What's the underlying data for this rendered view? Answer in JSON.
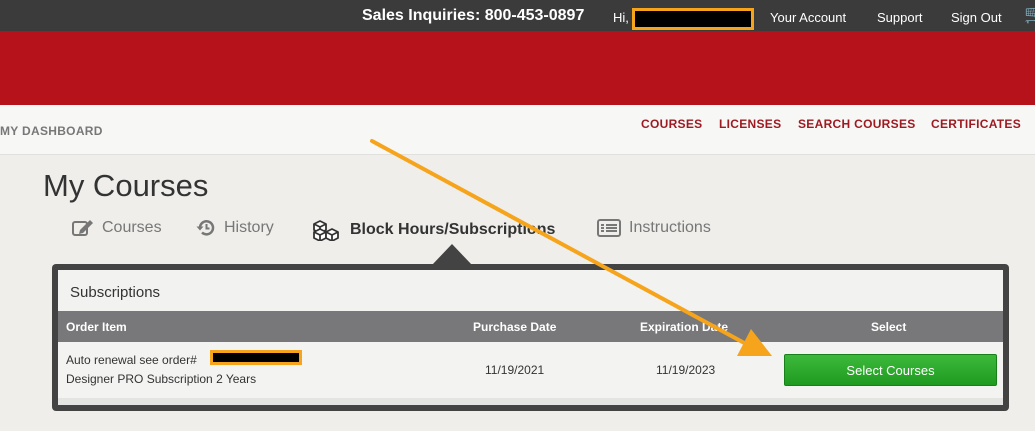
{
  "topbar": {
    "sales_inquiries": "Sales Inquiries: 800-453-0897",
    "greeting": "Hi,",
    "links": [
      "Your Account",
      "Support",
      "Sign Out"
    ]
  },
  "nav": {
    "dashboard": "MY DASHBOARD",
    "links": [
      "COURSES",
      "LICENSES",
      "SEARCH COURSES",
      "CERTIFICATES"
    ]
  },
  "page": {
    "title": "My Courses",
    "tabs": [
      {
        "label": "Courses",
        "icon": "edit-icon"
      },
      {
        "label": "History",
        "icon": "history-icon"
      },
      {
        "label": "Block Hours/Subscriptions",
        "icon": "blocks-icon",
        "active": true
      },
      {
        "label": "Instructions",
        "icon": "list-icon"
      }
    ]
  },
  "subscriptions": {
    "title": "Subscriptions",
    "headers": [
      "Order Item",
      "Purchase Date",
      "Expiration Date",
      "Select"
    ],
    "rows": [
      {
        "order_line1": "Auto renewal see order#",
        "order_line2": "Designer PRO Subscription 2 Years",
        "purchase_date": "11/19/2021",
        "expiration_date": "11/19/2023",
        "button": "Select Courses"
      }
    ]
  },
  "colors": {
    "topbar": "#3b3b3b",
    "banner": "#b5121b",
    "nav_link": "#9e1a22",
    "button_green": "#2aa82a",
    "annotation_orange": "#f5a41c"
  }
}
